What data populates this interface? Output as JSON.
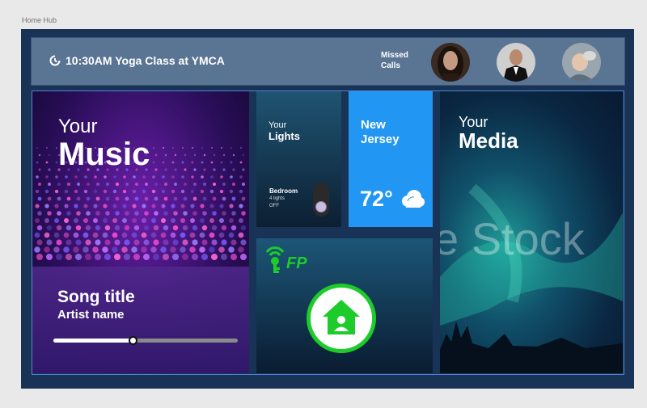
{
  "frame": {
    "label": "Home Hub"
  },
  "header": {
    "reminder_text": "10:30AM Yoga Class at YMCA",
    "missed_calls_line1": "Missed",
    "missed_calls_line2": "Calls",
    "contacts": [
      {
        "name": "contact-1"
      },
      {
        "name": "contact-2"
      },
      {
        "name": "contact-3"
      }
    ]
  },
  "music": {
    "prefix": "Your",
    "title": "Music",
    "song_title": "Song  title",
    "artist_name": "Artist  name",
    "progress": 0.43
  },
  "lights": {
    "prefix": "Your",
    "title": "Lights",
    "room": "Bedroom",
    "count": "4 lights",
    "state": "OFF"
  },
  "weather": {
    "city_line1": "New",
    "city_line2": "Jersey",
    "temperature": "72°",
    "icon": "cloud-icon"
  },
  "fp": {
    "logo_text": "FP",
    "icon": "home-person-icon"
  },
  "media": {
    "prefix": "Your",
    "title": "Media",
    "watermark": "e Stock"
  },
  "colors": {
    "device_bg": "#193356",
    "header_bg": "#5a7493",
    "weather_bg": "#2196f3",
    "fp_green": "#1dcc2a"
  }
}
